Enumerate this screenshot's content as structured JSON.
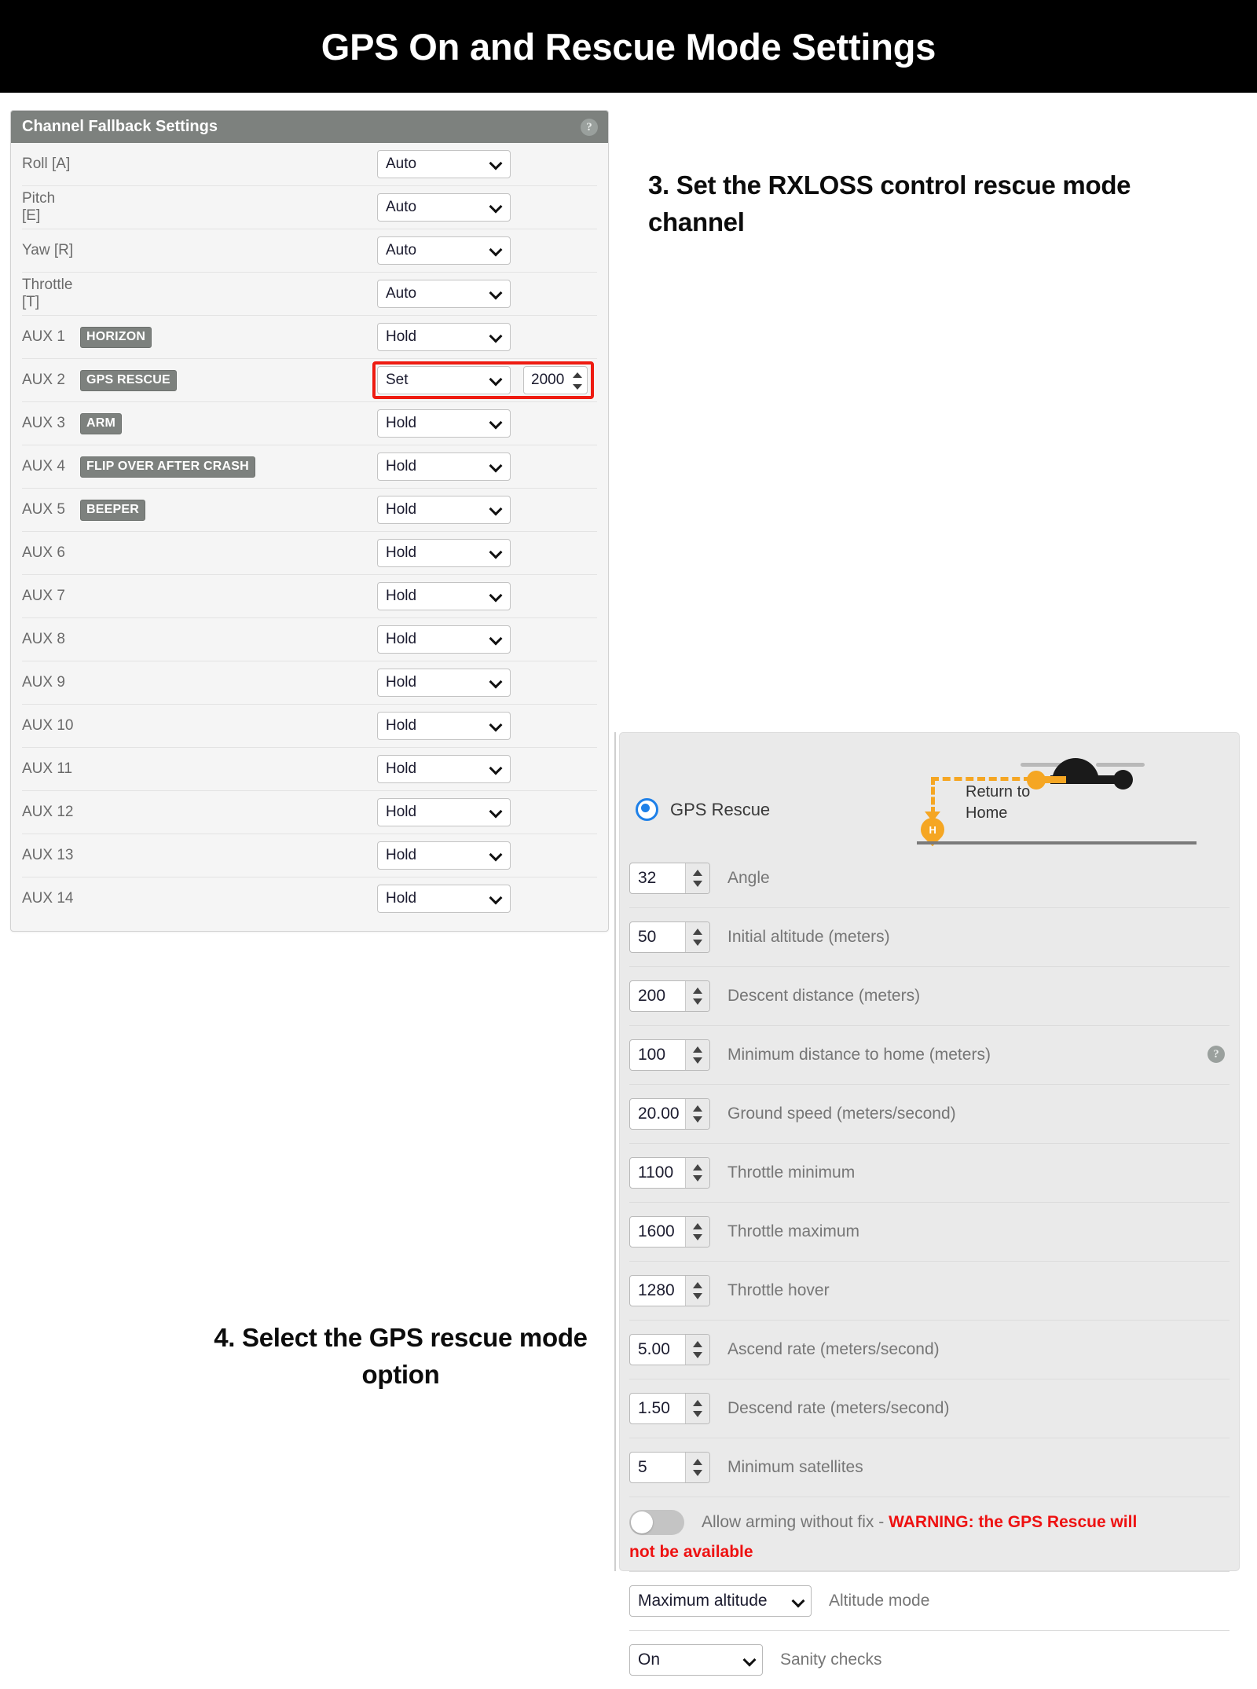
{
  "banner": {
    "title": "GPS On and Rescue Mode Settings"
  },
  "steps": {
    "step3": "3. Set the RXLOSS control rescue mode channel",
    "step4": "4. Select the GPS rescue mode option"
  },
  "fallback_panel": {
    "header": "Channel Fallback Settings",
    "help_icon": "?",
    "rows": [
      {
        "label": "Roll [A]",
        "badge": "",
        "value": "Auto",
        "num": ""
      },
      {
        "label": "Pitch [E]",
        "badge": "",
        "value": "Auto",
        "num": ""
      },
      {
        "label": "Yaw [R]",
        "badge": "",
        "value": "Auto",
        "num": ""
      },
      {
        "label": "Throttle [T]",
        "badge": "",
        "value": "Auto",
        "num": ""
      },
      {
        "label": "AUX 1",
        "badge": "HORIZON",
        "value": "Hold",
        "num": ""
      },
      {
        "label": "AUX 2",
        "badge": "GPS RESCUE",
        "value": "Set",
        "num": "2000",
        "highlighted": true
      },
      {
        "label": "AUX 3",
        "badge": "ARM",
        "value": "Hold",
        "num": ""
      },
      {
        "label": "AUX 4",
        "badge": "FLIP OVER AFTER CRASH",
        "value": "Hold",
        "num": ""
      },
      {
        "label": "AUX 5",
        "badge": "BEEPER",
        "value": "Hold",
        "num": ""
      },
      {
        "label": "AUX 6",
        "badge": "",
        "value": "Hold",
        "num": ""
      },
      {
        "label": "AUX 7",
        "badge": "",
        "value": "Hold",
        "num": ""
      },
      {
        "label": "AUX 8",
        "badge": "",
        "value": "Hold",
        "num": ""
      },
      {
        "label": "AUX 9",
        "badge": "",
        "value": "Hold",
        "num": ""
      },
      {
        "label": "AUX 10",
        "badge": "",
        "value": "Hold",
        "num": ""
      },
      {
        "label": "AUX 11",
        "badge": "",
        "value": "Hold",
        "num": ""
      },
      {
        "label": "AUX 12",
        "badge": "",
        "value": "Hold",
        "num": ""
      },
      {
        "label": "AUX 13",
        "badge": "",
        "value": "Hold",
        "num": ""
      },
      {
        "label": "AUX 14",
        "badge": "",
        "value": "Hold",
        "num": ""
      }
    ],
    "highlight_color": "#ee1b11"
  },
  "gps_panel": {
    "mode_label": "GPS Rescue",
    "mode_selected": true,
    "illustration": {
      "caption": "Return to Home",
      "home_marker": "H",
      "path_color": "#f5a623"
    },
    "settings": [
      {
        "value": "32",
        "label": "Angle"
      },
      {
        "value": "50",
        "label": "Initial altitude (meters)"
      },
      {
        "value": "200",
        "label": "Descent distance (meters)"
      },
      {
        "value": "100",
        "label": "Minimum distance to home (meters)",
        "help": "?"
      },
      {
        "value": "20.00",
        "label": "Ground speed (meters/second)"
      },
      {
        "value": "1100",
        "label": "Throttle minimum"
      },
      {
        "value": "1600",
        "label": "Throttle maximum"
      },
      {
        "value": "1280",
        "label": "Throttle hover"
      },
      {
        "value": "5.00",
        "label": "Ascend rate (meters/second)"
      },
      {
        "value": "1.50",
        "label": "Descend rate (meters/second)"
      },
      {
        "value": "5",
        "label": "Minimum satellites"
      }
    ],
    "arming_toggle": {
      "state": "off",
      "label_prefix": "Allow arming without fix - ",
      "warning_line1": "WARNING: the GPS Rescue will",
      "warning_line2": "not be available",
      "warning_color": "#ee1111"
    },
    "altitude_mode": {
      "value": "Maximum altitude",
      "label": "Altitude mode"
    },
    "sanity_checks": {
      "value": "On",
      "label": "Sanity checks"
    }
  }
}
